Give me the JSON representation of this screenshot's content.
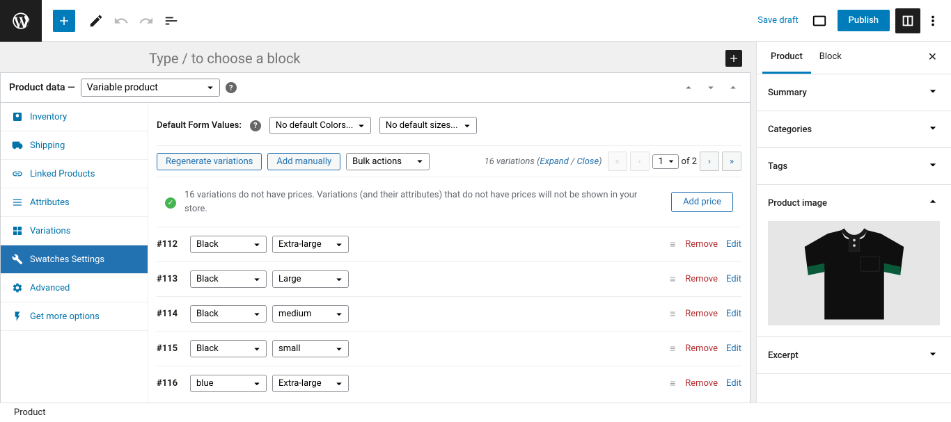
{
  "toolbar": {
    "save_draft": "Save draft",
    "publish": "Publish"
  },
  "editor": {
    "block_hint": "Type / to choose a block"
  },
  "product_data": {
    "label": "Product data —",
    "type": "Variable product",
    "tabs": [
      {
        "label": "Inventory",
        "icon": "inventory"
      },
      {
        "label": "Shipping",
        "icon": "shipping"
      },
      {
        "label": "Linked Products",
        "icon": "linked"
      },
      {
        "label": "Attributes",
        "icon": "attributes"
      },
      {
        "label": "Variations",
        "icon": "variations"
      },
      {
        "label": "Swatches Settings",
        "icon": "swatches",
        "active": true
      },
      {
        "label": "Advanced",
        "icon": "advanced"
      },
      {
        "label": "Get more options",
        "icon": "more"
      }
    ],
    "default_form_label": "Default Form Values:",
    "default_color": "No default Colors...",
    "default_size": "No default sizes...",
    "regenerate": "Regenerate variations",
    "add_manually": "Add manually",
    "bulk_actions": "Bulk actions",
    "variation_count": "16 variations",
    "expand": "Expand",
    "close": "Close",
    "page_current": "1",
    "page_of": "of 2",
    "notice": "16 variations do not have prices. Variations (and their attributes) that do not have prices will not be shown in your store.",
    "add_price": "Add price",
    "remove": "Remove",
    "edit": "Edit",
    "variations": [
      {
        "id": "#112",
        "color": "Black",
        "size": "Extra-large"
      },
      {
        "id": "#113",
        "color": "Black",
        "size": "Large"
      },
      {
        "id": "#114",
        "color": "Black",
        "size": "medium"
      },
      {
        "id": "#115",
        "color": "Black",
        "size": "small"
      },
      {
        "id": "#116",
        "color": "blue",
        "size": "Extra-large"
      }
    ]
  },
  "sidebar": {
    "tab_product": "Product",
    "tab_block": "Block",
    "panels": {
      "summary": "Summary",
      "categories": "Categories",
      "tags": "Tags",
      "product_image": "Product image",
      "excerpt": "Excerpt"
    }
  },
  "footer": {
    "breadcrumb": "Product"
  }
}
